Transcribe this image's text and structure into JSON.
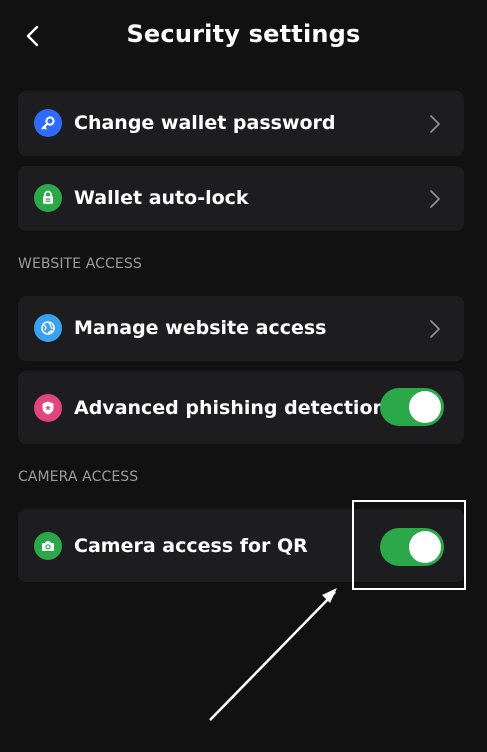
{
  "header": {
    "title": "Security settings",
    "back_icon": "chevron-left-icon"
  },
  "items": {
    "change_password": {
      "label": "Change wallet password",
      "icon": "key-icon",
      "icon_color": "#2f6bff"
    },
    "auto_lock": {
      "label": "Wallet auto-lock",
      "icon": "lock-icon",
      "icon_color": "#2ba84a"
    },
    "website_access": {
      "label": "Manage website access",
      "icon": "globe-icon",
      "icon_color": "#3aa0f0"
    },
    "phishing": {
      "label": "Advanced phishing detection",
      "icon": "shield-icon",
      "icon_color": "#e0457b",
      "enabled": true
    },
    "camera": {
      "label": "Camera access for QR",
      "icon": "camera-icon",
      "icon_color": "#2ba84a",
      "enabled": true
    }
  },
  "sections": {
    "website_access": "WEBSITE ACCESS",
    "camera_access": "CAMERA ACCESS"
  },
  "annotation": {
    "highlight": "highlight box around camera access toggle",
    "arrow": "arrow pointing to toggle"
  },
  "colors": {
    "background": "#111112",
    "card": "#1d1d1f",
    "toggle_on": "#2ba84a",
    "section_text": "#9a9a9c"
  }
}
